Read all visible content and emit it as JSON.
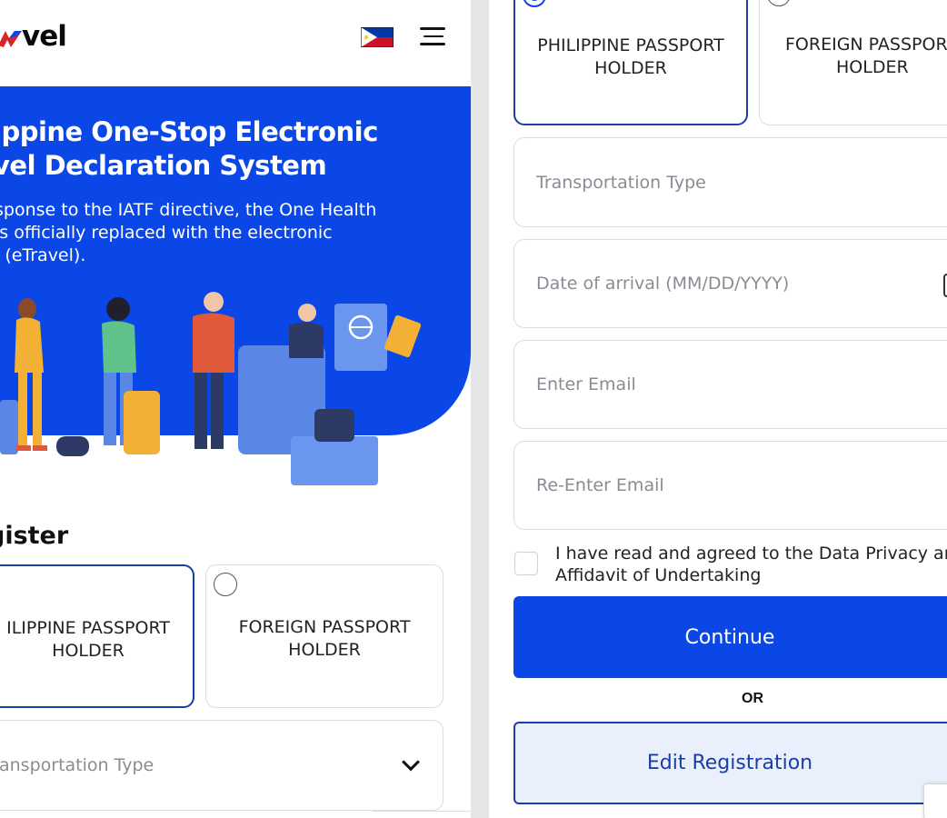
{
  "header": {
    "logo_text": "vel",
    "flag_icon": "philippines-flag-icon",
    "menu_icon": "hamburger-menu-icon"
  },
  "hero": {
    "title_line1": "ippine One-Stop Electronic",
    "title_line2": "vel Declaration System",
    "desc_line1": "sponse to the IATF directive, the One Health",
    "desc_line2": "is officially replaced with the electronic",
    "desc_line3": "l (eTravel).",
    "bg_color": "#0a47e6"
  },
  "left_form": {
    "register_title": "gister",
    "ph_passport_line1": "ILIPPINE PASSPORT",
    "ph_passport_line2": "HOLDER",
    "foreign_passport_line1": "FOREIGN PASSPORT",
    "foreign_passport_line2": "HOLDER",
    "transport_placeholder": "ansportation Type"
  },
  "right_form": {
    "ph_passport_line1": "PHILIPPINE PASSPORT",
    "ph_passport_line2": "HOLDER",
    "foreign_passport_line1": "FOREIGN PASSPOR",
    "foreign_passport_line2": "HOLDER",
    "transport_placeholder": "Transportation Type",
    "date_placeholder": "Date of arrival (MM/DD/YYYY)",
    "email_placeholder": "Enter Email",
    "reemail_placeholder": "Re-Enter Email",
    "consent_line1": "I have read and agreed to the Data Privacy an",
    "consent_line2": "Affidavit of Undertaking",
    "continue_label": "Continue",
    "or_label": "OR",
    "edit_label": "Edit Registration"
  },
  "colors": {
    "primary": "#0a47e6",
    "selected_border": "#1a3ea8",
    "edit_bg": "#e9f0fc"
  }
}
